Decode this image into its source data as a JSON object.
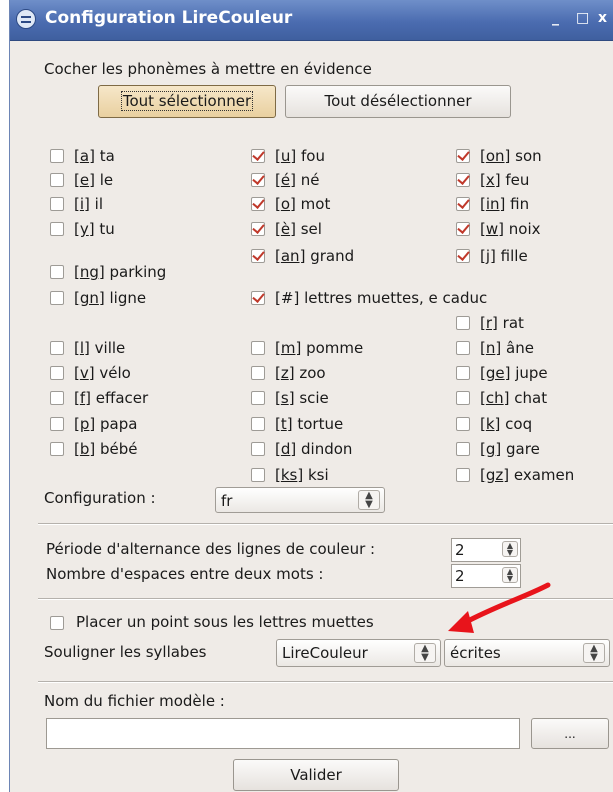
{
  "window": {
    "title": "Configuration LireCouleur",
    "minimize_label": "_",
    "maximize_label": "□",
    "close_label": "x"
  },
  "phoneme_section": {
    "heading": "Cocher les phonèmes à mettre en évidence",
    "select_all_label": "Tout sélectionner",
    "deselect_all_label": "Tout désélectionner"
  },
  "phonemes": [
    {
      "code": "a",
      "word": "ta",
      "checked": false
    },
    {
      "code": "u",
      "word": "fou",
      "checked": true
    },
    {
      "code": "on",
      "word": "son",
      "checked": true
    },
    {
      "code": "e",
      "word": "le",
      "checked": false
    },
    {
      "code": "é",
      "word": "né",
      "checked": true
    },
    {
      "code": "x",
      "word": "feu",
      "checked": true
    },
    {
      "code": "i",
      "word": "il",
      "checked": false
    },
    {
      "code": "o",
      "word": "mot",
      "checked": true
    },
    {
      "code": "in",
      "word": "fin",
      "checked": true
    },
    {
      "code": "y",
      "word": "tu",
      "checked": false
    },
    {
      "code": "è",
      "word": "sel",
      "checked": true
    },
    {
      "code": "w",
      "word": "noix",
      "checked": true
    },
    {
      "code": "an",
      "word": "grand",
      "checked": true
    },
    {
      "code": "j",
      "word": "fille",
      "checked": true
    },
    {
      "code": "ng",
      "word": "parking",
      "checked": false
    },
    {
      "code": "gn",
      "word": "ligne",
      "checked": false
    },
    {
      "code": "#",
      "word": "lettres muettes, e caduc",
      "checked": true
    },
    {
      "code": "r",
      "word": "rat",
      "checked": false
    },
    {
      "code": "l",
      "word": "ville",
      "checked": false
    },
    {
      "code": "m",
      "word": "pomme",
      "checked": false
    },
    {
      "code": "n",
      "word": "âne",
      "checked": false
    },
    {
      "code": "v",
      "word": "vélo",
      "checked": false
    },
    {
      "code": "z",
      "word": "zoo",
      "checked": false
    },
    {
      "code": "ge",
      "word": "jupe",
      "checked": false
    },
    {
      "code": "f",
      "word": "effacer",
      "checked": false
    },
    {
      "code": "s",
      "word": "scie",
      "checked": false
    },
    {
      "code": "ch",
      "word": "chat",
      "checked": false
    },
    {
      "code": "p",
      "word": "papa",
      "checked": false
    },
    {
      "code": "t",
      "word": "tortue",
      "checked": false
    },
    {
      "code": "k",
      "word": "coq",
      "checked": false
    },
    {
      "code": "b",
      "word": "bébé",
      "checked": false
    },
    {
      "code": "d",
      "word": "dindon",
      "checked": false
    },
    {
      "code": "g",
      "word": "gare",
      "checked": false
    },
    {
      "code": "ks",
      "word": "ksi",
      "checked": false
    },
    {
      "code": "gz",
      "word": "examen",
      "checked": false
    }
  ],
  "configuration": {
    "label": "Configuration :",
    "value": "fr"
  },
  "alternance": {
    "label": "Période d'alternance des lignes de couleur :",
    "value": "2"
  },
  "espaces": {
    "label": "Nombre d'espaces entre deux mots :",
    "value": "2"
  },
  "point_muettes": {
    "label": "Placer un point sous les lettres muettes",
    "checked": false
  },
  "syllabes": {
    "label": "Souligner les syllabes",
    "mode_value": "LireCouleur",
    "type_value": "écrites"
  },
  "fichier": {
    "label": "Nom du fichier modèle :",
    "value": "",
    "browse_label": "..."
  },
  "validate_label": "Valider",
  "colors": {
    "titlebar": "#4b6cb0",
    "check_mark": "#c0392b",
    "annotation_arrow": "#e8141b",
    "window_bg": "#efebe7"
  }
}
